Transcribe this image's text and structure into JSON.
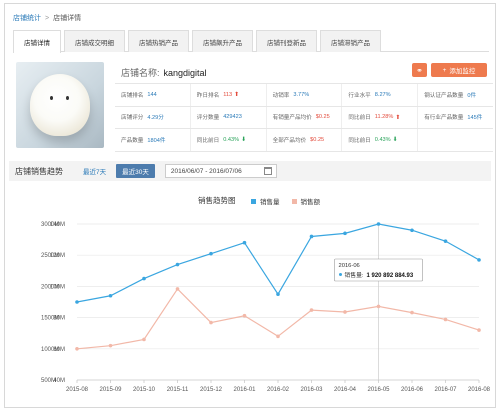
{
  "breadcrumb": {
    "root": "店铺统计",
    "separator": ">",
    "current": "店铺详情"
  },
  "tabs": [
    "店铺详情",
    "店铺成交明细",
    "店铺热销产品",
    "店铺飙升产品",
    "店铺刊登新品",
    "店铺滞销产品"
  ],
  "store": {
    "name_label": "店铺名称:",
    "name": "kangdigital",
    "monitor_label": "添加监控",
    "plus_icon": "+",
    "link_icon": "⚭"
  },
  "metrics": [
    [
      {
        "label": "店铺排名",
        "value": "144",
        "color": "blue"
      },
      {
        "label": "昨日排名",
        "value": "113",
        "color": "red",
        "arrow": "up"
      },
      {
        "label": "动销率",
        "value": "3.77%",
        "color": "blue"
      },
      {
        "label": "行业水平",
        "value": "8.27%",
        "color": "blue"
      },
      {
        "label": "钢认证产品数量",
        "value": "0件",
        "color": "blue"
      }
    ],
    [
      {
        "label": "店铺评分",
        "value": "4.29分",
        "color": "blue"
      },
      {
        "label": "评分数量",
        "value": "429423",
        "color": "blue"
      },
      {
        "label": "有销量产品均价",
        "value": "$0.25",
        "color": "red"
      },
      {
        "label": "同比前日",
        "value": "11.28%",
        "color": "red",
        "arrow": "up"
      },
      {
        "label": "有行业产品数量",
        "value": "145件",
        "color": "blue"
      }
    ],
    [
      {
        "label": "产品数量",
        "value": "1804件",
        "color": "blue"
      },
      {
        "label": "同比前日",
        "value": "0.43%",
        "color": "green",
        "arrow": "down"
      },
      {
        "label": "全部产品均价",
        "value": "$0.25",
        "color": "red"
      },
      {
        "label": "同比前日",
        "value": "0.43%",
        "color": "green",
        "arrow": "down"
      },
      {
        "label": "",
        "value": "",
        "color": "blue"
      }
    ]
  ],
  "trend": {
    "title": "店铺销售趋势",
    "range_7": "最近7天",
    "range_30": "最近30天",
    "date_range": "2016/06/07 - 2016/07/06"
  },
  "colors": {
    "quantity": "#3aa6e0",
    "amount": "#f2b8a8",
    "accent": "#ee7a4e",
    "link": "#2a7ab8"
  },
  "chart_data": {
    "type": "line",
    "title": "销售趋势图",
    "categories": [
      "2015-08",
      "2015-09",
      "2015-10",
      "2015-11",
      "2015-12",
      "2016-01",
      "2016-02",
      "2016-03",
      "2016-04",
      "2016-05",
      "2016-06",
      "2016-07",
      "2016-08"
    ],
    "series": [
      {
        "name": "销售量",
        "axis": "right",
        "values": [
          90,
          94,
          105,
          114,
          121,
          128,
          95,
          132,
          134,
          140,
          136,
          129,
          117
        ]
      },
      {
        "name": "销售额",
        "axis": "left",
        "values": [
          1000,
          1050,
          1150,
          1960,
          1420,
          1530,
          1200,
          1620,
          1590,
          1680,
          1580,
          1470,
          1300
        ]
      }
    ],
    "y_left": {
      "ticks": [
        "500M",
        "1000M",
        "1500M",
        "2000M",
        "2500M",
        "3000M"
      ],
      "min": 500,
      "max": 3000
    },
    "y_right": {
      "ticks": [
        "40M",
        "60M",
        "80M",
        "100M",
        "120M",
        "140M"
      ],
      "min": 40,
      "max": 140
    },
    "grid": true,
    "legend": "top-center",
    "tooltip": {
      "date": "2016-06",
      "label": "销售量:",
      "value": "1 920 892 884.93",
      "category_index": 9
    }
  }
}
